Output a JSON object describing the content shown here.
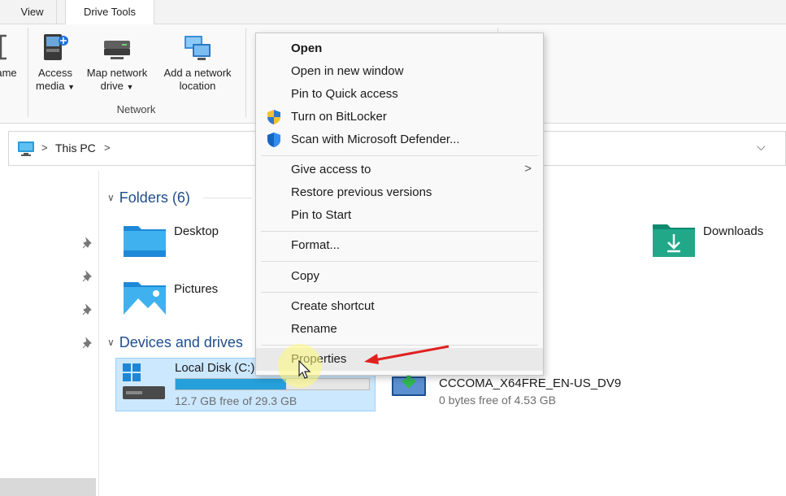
{
  "ribbon": {
    "tabs": [
      "View",
      "Drive Tools"
    ],
    "buttons": {
      "rename": "ame",
      "access_media_1": "Access",
      "access_media_2": "media",
      "map_drive_1": "Map network",
      "map_drive_2": "drive",
      "add_location_1": "Add a network",
      "add_location_2": "location"
    },
    "group_label": "Network"
  },
  "address": {
    "crumb": "This PC",
    "separator": ">"
  },
  "content": {
    "folders_header": "Folders (6)",
    "folders": [
      "Desktop",
      "Downloads",
      "Pictures"
    ],
    "devices_header": "Devices and drives",
    "drives": [
      {
        "name": "Local Disk (C:)",
        "free": "12.7 GB free of 29.3 GB",
        "used_fraction": 0.57
      },
      {
        "name": "CCCOMA_X64FRE_EN-US_DV9",
        "free": "0 bytes free of 4.53 GB"
      }
    ]
  },
  "context_menu": {
    "items": [
      {
        "label": "Open"
      },
      {
        "label": "Open in new window"
      },
      {
        "label": "Pin to Quick access"
      },
      {
        "label": "Turn on BitLocker"
      },
      {
        "label": "Scan with Microsoft Defender..."
      },
      {
        "label": "Give access to"
      },
      {
        "label": "Restore previous versions"
      },
      {
        "label": "Pin to Start"
      },
      {
        "label": "Format..."
      },
      {
        "label": "Copy"
      },
      {
        "label": "Create shortcut"
      },
      {
        "label": "Rename"
      },
      {
        "label": "Properties"
      }
    ],
    "submenu_arrow": ">"
  },
  "colors": {
    "selection": "#cce8ff",
    "drive_bar": "#26a0da",
    "header_text": "#1e4e8c",
    "annotation_arrow": "#e02020"
  }
}
